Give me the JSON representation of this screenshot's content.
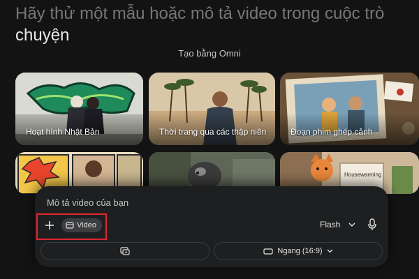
{
  "heading": {
    "line1": "Hãy thử một mẫu hoặc mô tả video trong cuộc trò",
    "line2": "chuyện"
  },
  "subtitle": "Tạo bằng Omni",
  "cards": [
    {
      "label": "Hoạt hình Nhật Bản"
    },
    {
      "label": "Thời trang qua các thập niên"
    },
    {
      "label": "Đoạn phim ghép cảnh"
    },
    {
      "label": ""
    },
    {
      "label": ""
    },
    {
      "label": "Housewarming"
    }
  ],
  "composer": {
    "placeholder": "Mô tả video của bạn",
    "chip_label": "Video",
    "model_label": "Flash",
    "aspect_label": "Ngang (16:9)"
  },
  "icons": {
    "plus": "plus-icon",
    "chip": "video-icon",
    "model_chevron": "chevron-down-icon",
    "mic": "microphone-icon",
    "frames": "frames-icon",
    "aspect": "aspect-ratio-icon",
    "aspect_chevron": "chevron-down-icon"
  },
  "colors": {
    "background": "#131314",
    "panel": "#1e1f20",
    "highlight": "#e0262f",
    "chip": "#3c3d3f"
  }
}
